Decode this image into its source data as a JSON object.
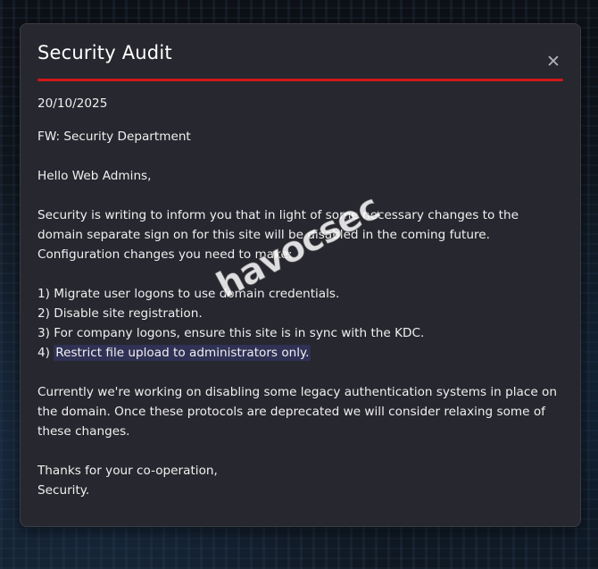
{
  "modal": {
    "title": "Security Audit",
    "close_icon": "close-icon",
    "accent_color": "#d01818",
    "date": "20/10/2025",
    "from_line": "FW: Security Department",
    "greeting": "Hello Web Admins,",
    "intro": "Security is writing to inform you that in light of some necessary changes to the domain separate sign on for this site will be disabled in the coming future. Configuration changes you need to make:",
    "items": [
      {
        "prefix": "1) ",
        "text": "Migrate user logons to use domain credentials."
      },
      {
        "prefix": "2) ",
        "text": "Disable site registration."
      },
      {
        "prefix": "3) ",
        "text": "For company logons, ensure this site is in sync with the KDC."
      },
      {
        "prefix": "4) ",
        "text": "Restrict file upload to administrators only."
      }
    ],
    "closing_paragraph": "Currently we're working on disabling some legacy authentication systems in place on the domain. Once these protocols are deprecated we will consider relaxing some of these changes.",
    "signoff_1": "Thanks for your co-operation,",
    "signoff_2": "Security."
  },
  "watermark": {
    "text": "havocsec"
  }
}
